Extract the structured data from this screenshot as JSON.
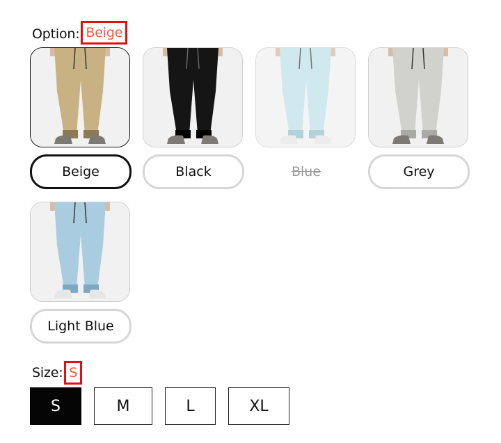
{
  "option": {
    "label": "Option:",
    "selected": "Beige",
    "swatches": [
      {
        "name": "Beige",
        "pant_color": "#c8b183",
        "dark": "#8e7a54",
        "state": "selected"
      },
      {
        "name": "Black",
        "pant_color": "#151515",
        "dark": "#000000",
        "state": "available"
      },
      {
        "name": "Blue",
        "pant_color": "#bfe2ea",
        "dark": "#98c3cf",
        "state": "unavailable"
      },
      {
        "name": "Grey",
        "pant_color": "#d1d1ce",
        "dark": "#a9a9a6",
        "state": "available"
      },
      {
        "name": "Light Blue",
        "pant_color": "#a9cce0",
        "dark": "#7fa8c4",
        "state": "available"
      }
    ]
  },
  "size": {
    "label": "Size:",
    "selected": "S",
    "options": [
      "S",
      "M",
      "L",
      "XL"
    ]
  },
  "colors": {
    "highlight_border": "#e01010",
    "highlight_text": "#ef5a3c",
    "selected_border": "#111111",
    "default_border": "#d6d6d6"
  }
}
